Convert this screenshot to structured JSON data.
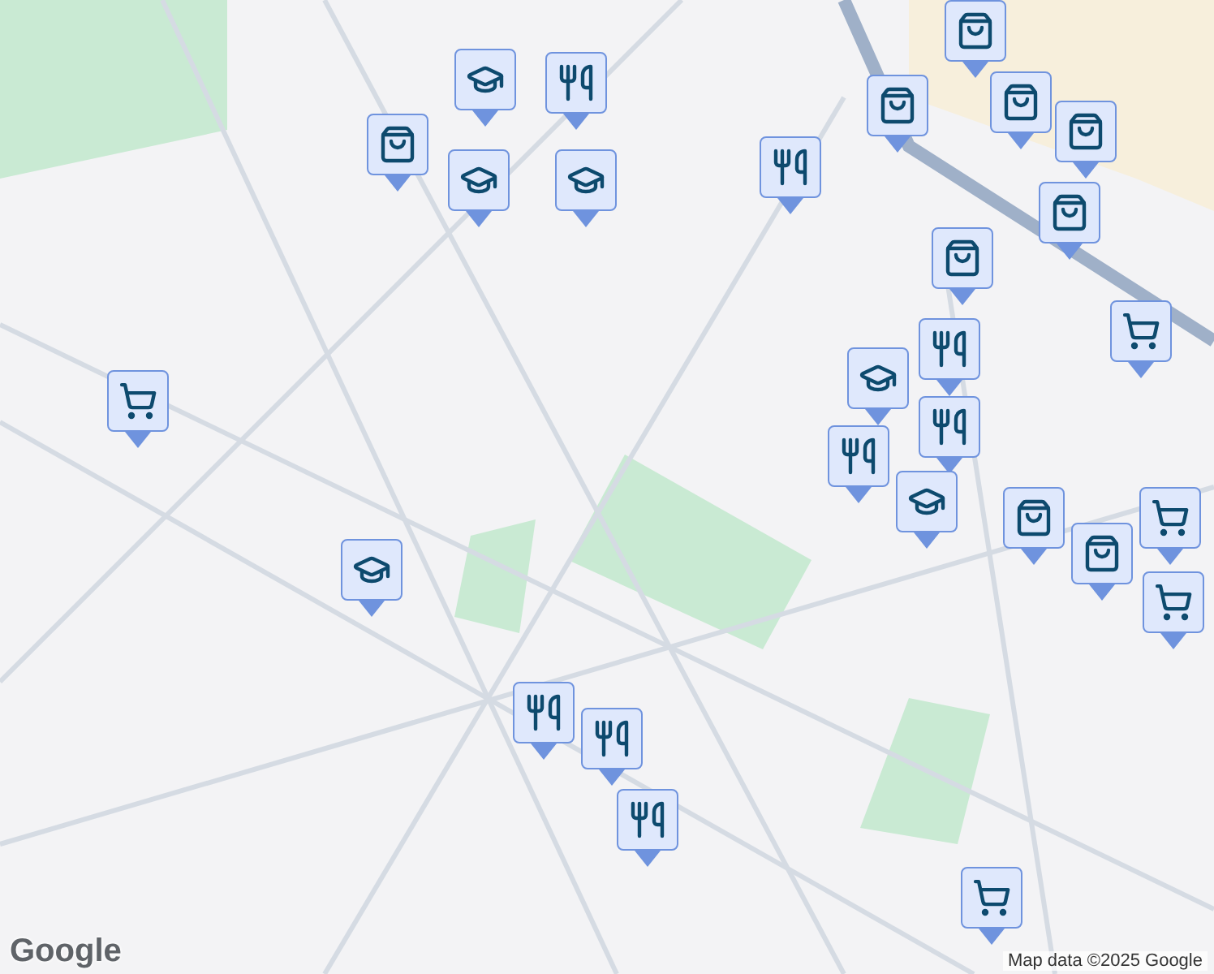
{
  "map": {
    "markers": [
      {
        "kind": "school"
      },
      {
        "kind": "shop"
      },
      {
        "kind": "school"
      },
      {
        "kind": "restaurant"
      },
      {
        "kind": "school"
      },
      {
        "kind": "restaurant"
      },
      {
        "kind": "shop"
      },
      {
        "kind": "shop"
      },
      {
        "kind": "shop"
      },
      {
        "kind": "shop"
      },
      {
        "kind": "shop"
      },
      {
        "kind": "shop"
      },
      {
        "kind": "grocery"
      },
      {
        "kind": "restaurant"
      },
      {
        "kind": "school"
      },
      {
        "kind": "restaurant"
      },
      {
        "kind": "restaurant"
      },
      {
        "kind": "school"
      },
      {
        "kind": "shop"
      },
      {
        "kind": "shop"
      },
      {
        "kind": "grocery"
      },
      {
        "kind": "grocery"
      },
      {
        "kind": "grocery"
      },
      {
        "kind": "school"
      },
      {
        "kind": "restaurant"
      },
      {
        "kind": "restaurant"
      },
      {
        "kind": "restaurant"
      },
      {
        "kind": "grocery"
      }
    ],
    "logo": "Google",
    "attribution": "Map data ©2025 Google"
  }
}
